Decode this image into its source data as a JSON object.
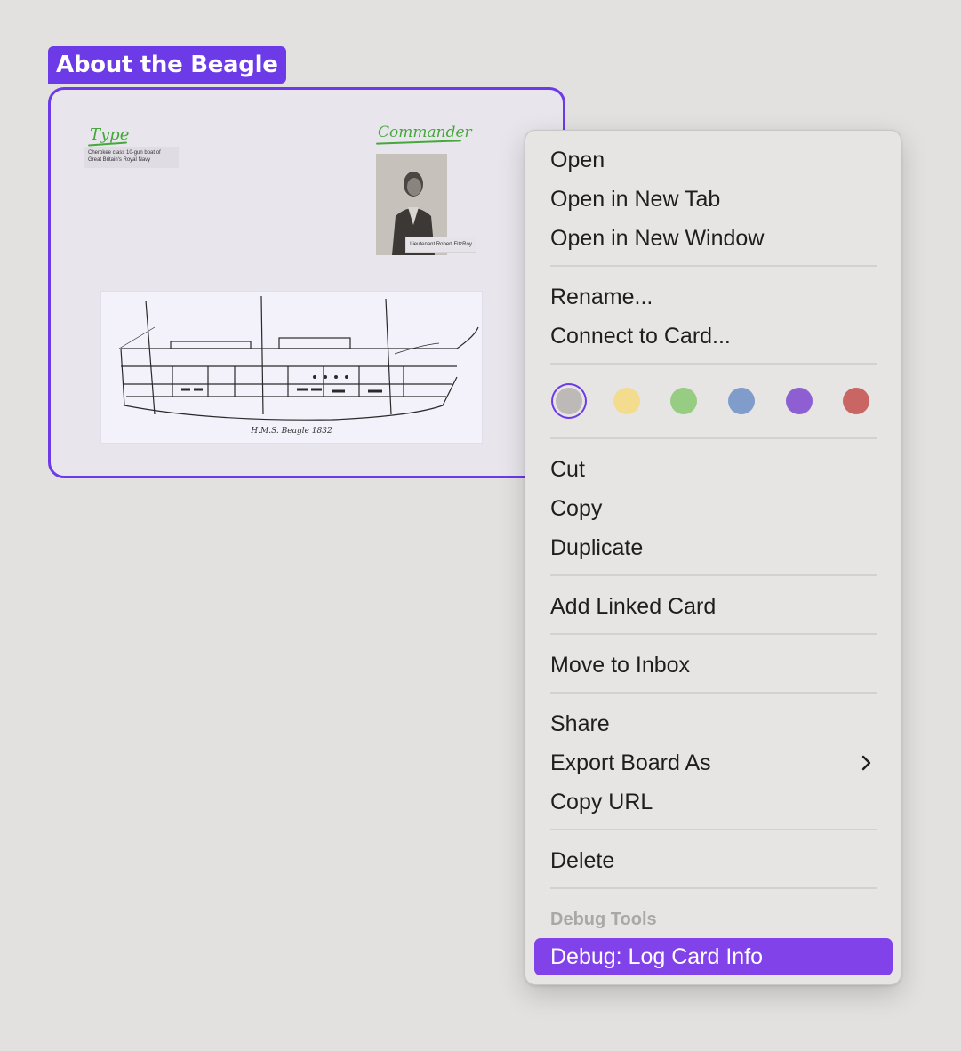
{
  "board": {
    "title": "About the Beagle",
    "type_label": "Type",
    "type_note": "Cherokee class 10-gun boat of Great Britain's Royal Navy",
    "commander_label": "Commander",
    "portrait_caption": "Lieutenant Robert FitzRoy",
    "ship_caption": "H.M.S. Beagle 1832"
  },
  "menu": {
    "open": "Open",
    "open_new_tab": "Open in New Tab",
    "open_new_window": "Open in New Window",
    "rename": "Rename...",
    "connect_to_card": "Connect to Card...",
    "cut": "Cut",
    "copy": "Copy",
    "duplicate": "Duplicate",
    "add_linked_card": "Add Linked Card",
    "move_to_inbox": "Move to Inbox",
    "share": "Share",
    "export_board_as": "Export Board As",
    "copy_url": "Copy URL",
    "delete": "Delete",
    "debug_header": "Debug Tools",
    "debug_log_card_info": "Debug: Log Card Info"
  },
  "colors": {
    "accent": "#6d3ae8",
    "highlight": "#8242ea",
    "swatches": [
      {
        "name": "gray",
        "hex": "#bcb9b7",
        "selected": true
      },
      {
        "name": "yellow",
        "hex": "#f4dc8e",
        "selected": false
      },
      {
        "name": "green",
        "hex": "#97cc83",
        "selected": false
      },
      {
        "name": "blue",
        "hex": "#7f9ccb",
        "selected": false
      },
      {
        "name": "purple",
        "hex": "#8e5fd2",
        "selected": false
      },
      {
        "name": "red",
        "hex": "#c96664",
        "selected": false
      }
    ]
  },
  "icons": {
    "submenu": "chevron-right-icon"
  }
}
